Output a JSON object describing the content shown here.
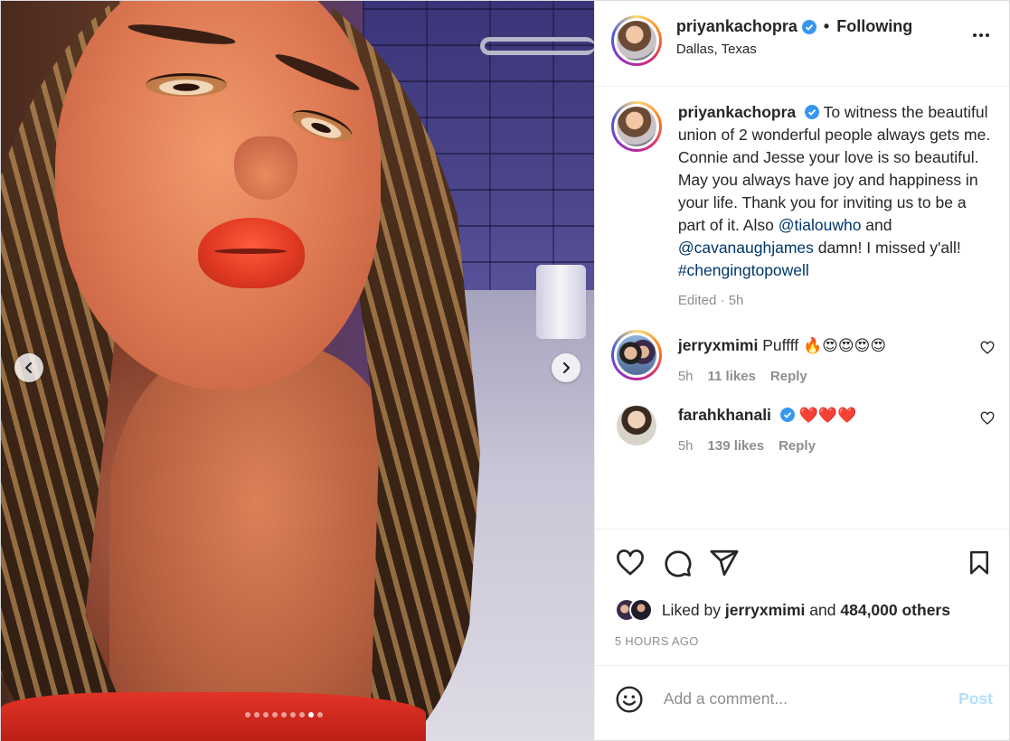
{
  "author": {
    "username": "priyankachopra",
    "follow_status": "Following",
    "separator": "•",
    "location": "Dallas, Texas"
  },
  "media": {
    "carousel_total": 9,
    "carousel_active_index": 7
  },
  "caption": {
    "username": "priyankachopra",
    "text_1": "To witness the beautiful union of 2 wonderful people always gets me. Connie and Jesse your love is so beautiful. May you always have joy and happiness in your life. Thank you for inviting us to be a part of it. Also ",
    "mention_1": "@tialouwho",
    "text_2": " and ",
    "mention_2": "@cavanaughjames",
    "text_3": " damn! I missed y'all!",
    "hashtag": "#chengingtopowell",
    "meta": "Edited · 5h"
  },
  "comments": [
    {
      "username": "jerryxmimi",
      "text": "Puffff",
      "emojis": "🔥😍😍😍😍",
      "time": "5h",
      "likes": "11 likes",
      "reply": "Reply"
    },
    {
      "username": "farahkhanali",
      "text": "",
      "emojis": "❤️❤️❤️",
      "time": "5h",
      "likes": "139 likes",
      "reply": "Reply"
    }
  ],
  "likes": {
    "prefix": "Liked by",
    "user": "jerryxmimi",
    "middle": "and",
    "others": "484,000 others"
  },
  "timestamp": "5 HOURS AGO",
  "composer": {
    "placeholder": "Add a comment...",
    "post_label": "Post"
  },
  "colors": {
    "verified": "#3897f0",
    "link": "#00376b",
    "muted": "#8e8e8e",
    "post_disabled": "#b2dffc"
  }
}
